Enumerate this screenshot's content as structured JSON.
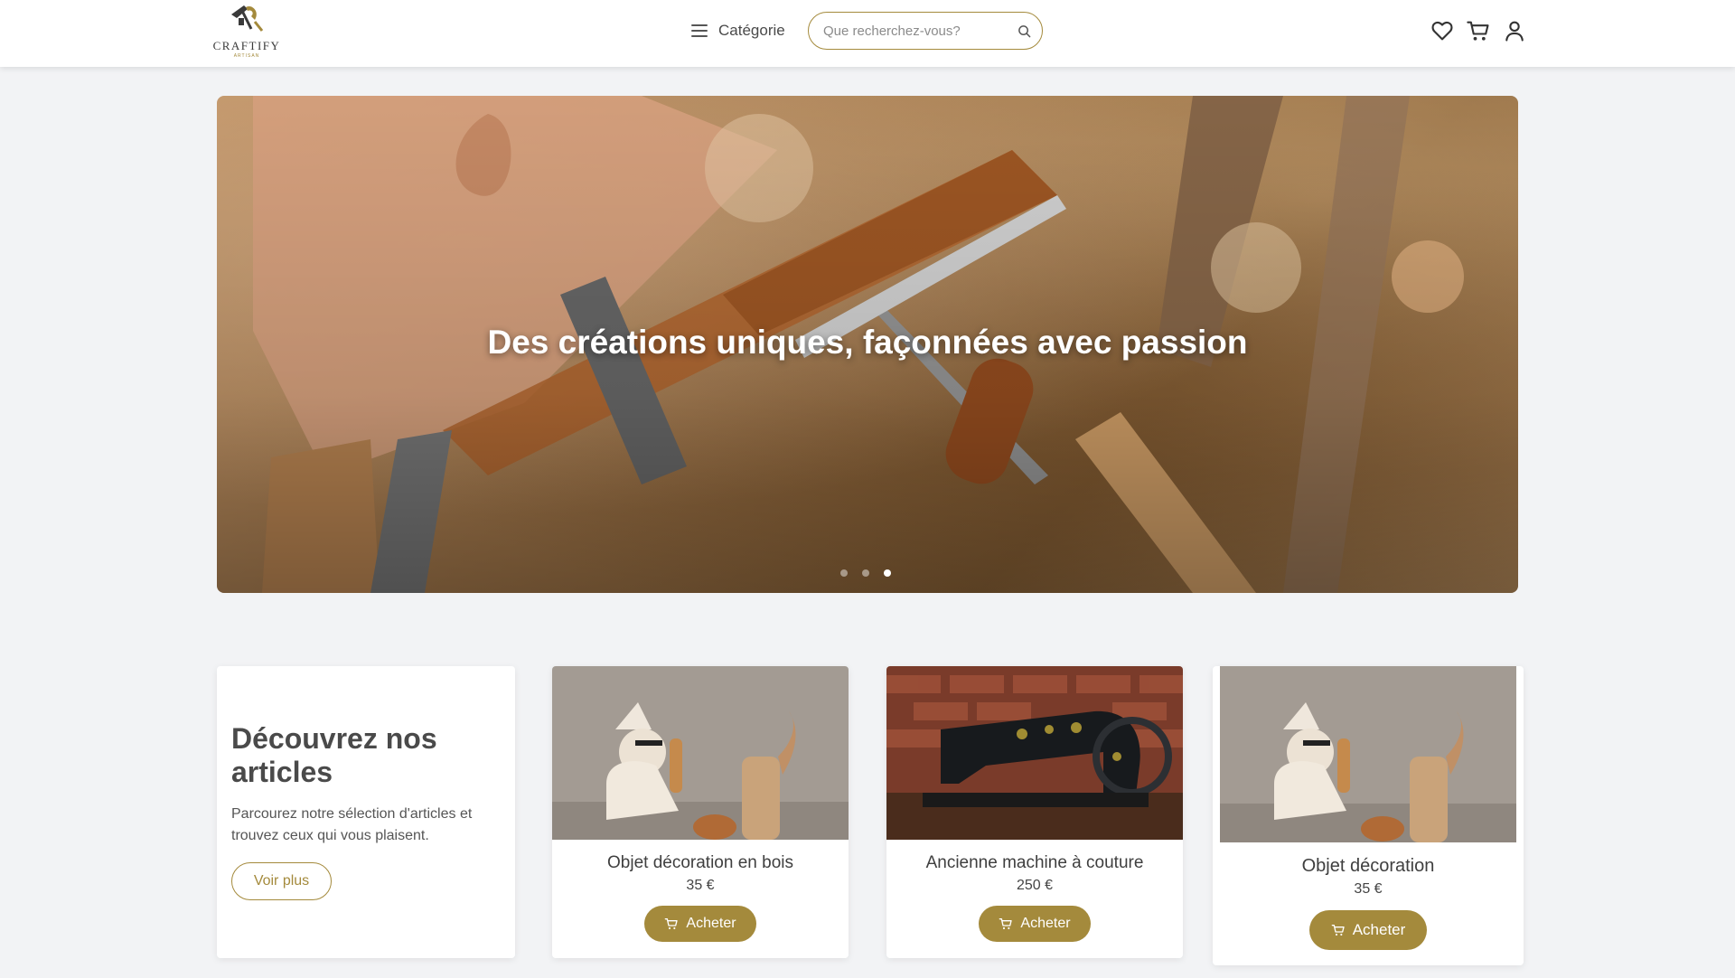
{
  "header": {
    "logo_text": "CRAFTIFY",
    "logo_subtext": "ARTISAN",
    "category_label": "Catégorie",
    "search_placeholder": "Que recherchez-vous?",
    "icons": [
      "menu-icon",
      "search-icon",
      "heart-icon",
      "cart-icon",
      "user-icon"
    ]
  },
  "hero": {
    "title": "Des créations uniques, façonnées avec passion",
    "slides_count": 3,
    "active_slide": 3
  },
  "intro": {
    "title": "Découvrez nos articles",
    "description": "Parcourez notre sélection d'articles et trouvez ceux qui vous plaisent.",
    "button_label": "Voir plus"
  },
  "products": [
    {
      "name": "Objet décoration en bois",
      "price": "35 €",
      "button_label": "Acheter"
    },
    {
      "name": "Ancienne machine à couture",
      "price": "250 €",
      "button_label": "Acheter"
    },
    {
      "name": "Objet décoration",
      "price": "35 €",
      "button_label": "Acheter"
    }
  ],
  "colors": {
    "accent": "#a48a3c",
    "page_background": "#f2f3f5",
    "text": "#4a4a4a"
  }
}
